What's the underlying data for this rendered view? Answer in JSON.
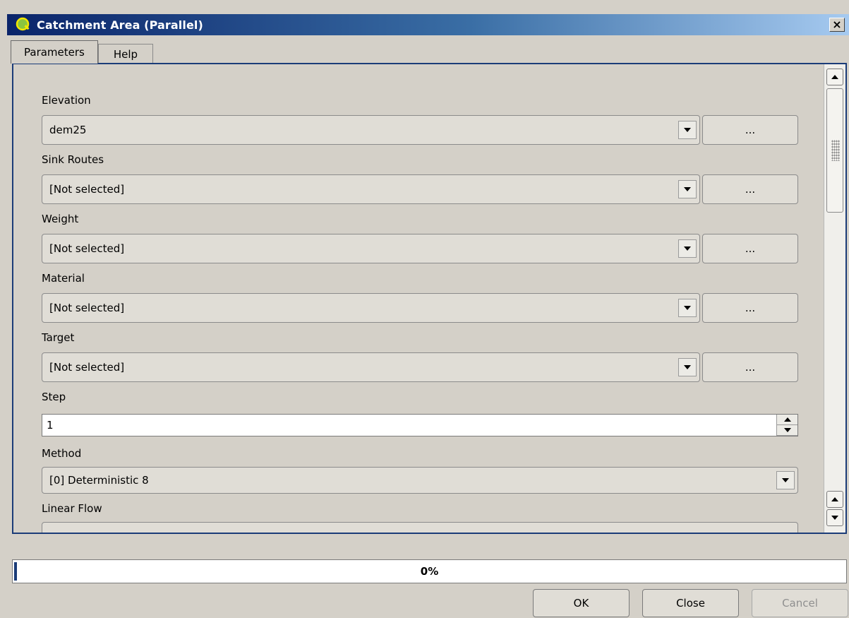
{
  "window": {
    "title": "Catchment Area (Parallel)",
    "close_glyph": "×"
  },
  "tabs": [
    {
      "label": "Parameters",
      "active": true
    },
    {
      "label": "Help",
      "active": false
    }
  ],
  "fields": {
    "elevation": {
      "label": "Elevation",
      "value": "dem25",
      "browse": "..."
    },
    "sink_routes": {
      "label": "Sink Routes",
      "value": "[Not selected]",
      "browse": "..."
    },
    "weight": {
      "label": "Weight",
      "value": "[Not selected]",
      "browse": "..."
    },
    "material": {
      "label": "Material",
      "value": "[Not selected]",
      "browse": "..."
    },
    "target": {
      "label": "Target",
      "value": "[Not selected]",
      "browse": "..."
    },
    "step": {
      "label": "Step",
      "value": "1"
    },
    "method": {
      "label": "Method",
      "value": "[0] Deterministic 8"
    },
    "linear_flow": {
      "label": "Linear Flow"
    }
  },
  "progress": {
    "text": "0%",
    "value": 0
  },
  "buttons": {
    "ok": "OK",
    "close": "Close",
    "cancel": "Cancel"
  },
  "icons": {
    "app": "qgis-logo-icon",
    "dropdown": "chevron-down-icon"
  },
  "colors": {
    "title_gradient_start": "#0a246a",
    "title_gradient_end": "#a6caf0",
    "accent": "#1b3c78"
  }
}
